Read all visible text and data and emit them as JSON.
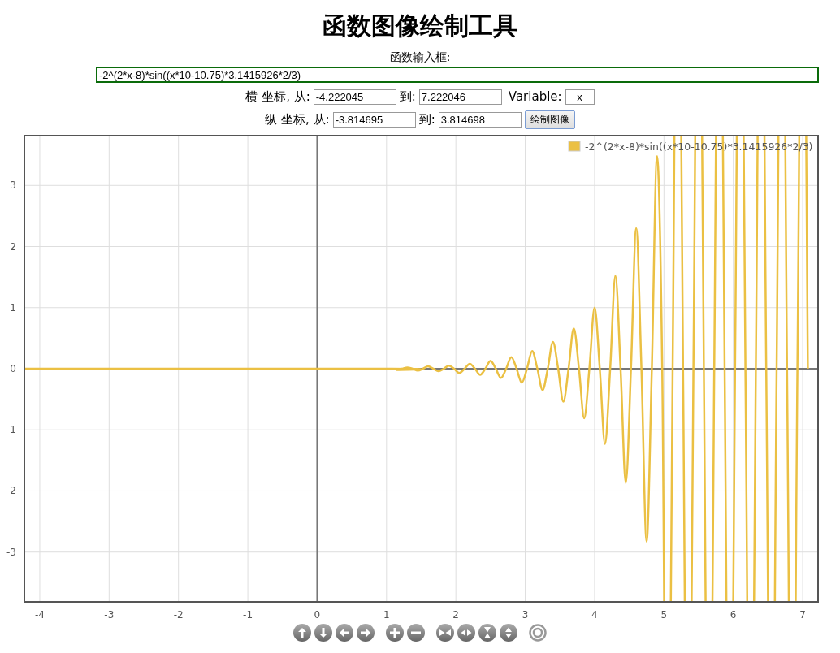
{
  "title": "函数图像绘制工具",
  "function_input": {
    "label": "函数输入框:",
    "value": "-2^(2*x-8)*sin((x*10-10.75)*3.1415926*2/3)"
  },
  "x_range": {
    "label": "横 坐标, 从:",
    "from": "-4.222045",
    "to_label": "到:",
    "to": "7.222046",
    "variable_label": "Variable:",
    "variable": "x"
  },
  "y_range": {
    "label": "纵 坐标, 从:",
    "from": "-3.814695",
    "to_label": "到:",
    "to": "3.814698"
  },
  "draw_button": "绘制图像",
  "plot": {
    "chart_data": {
      "type": "line",
      "x": [
        -4.222,
        1.075,
        1.15,
        1.225,
        1.3,
        1.375,
        1.45,
        1.525,
        1.6,
        1.675,
        1.75,
        1.825,
        1.9,
        1.975,
        2.05,
        2.125,
        2.2,
        2.275,
        2.35,
        2.425,
        2.5,
        2.575,
        2.65,
        2.725,
        2.8,
        2.875,
        2.95,
        3.025,
        3.1,
        3.175,
        3.25,
        3.325,
        3.4,
        3.475,
        3.55,
        3.625,
        3.7,
        3.775,
        3.85,
        3.925,
        4.0,
        4.075,
        4.15,
        4.225,
        4.3,
        4.375,
        4.45,
        4.525,
        4.6,
        4.675,
        4.75,
        4.825,
        4.9,
        4.975,
        5.05,
        5.125,
        5.2,
        5.275,
        5.35,
        5.425,
        5.5,
        5.575,
        5.65,
        5.725,
        5.8,
        5.875,
        5.95,
        6.025,
        6.1,
        6.175,
        6.25,
        6.325,
        6.4,
        6.475,
        6.55,
        6.625,
        6.7,
        6.775,
        6.85,
        6.925,
        7.0,
        7.075
      ],
      "series": [
        {
          "name": "-2^(2*x-8)*sin((x*10-10.75)*3.1415926*2/3)",
          "color": "#ebc043",
          "values": [
            0,
            0,
            -0.02,
            0,
            0.02,
            0,
            -0.03,
            0,
            0.04,
            0,
            -0.04,
            0,
            0.05,
            0,
            -0.07,
            0,
            0.08,
            0,
            -0.1,
            0,
            0.13,
            0,
            -0.15,
            0,
            0.19,
            0,
            -0.23,
            0,
            0.29,
            0,
            -0.35,
            0,
            0.44,
            0,
            -0.54,
            0,
            0.66,
            0,
            -0.81,
            0,
            1,
            0,
            -1.23,
            0,
            1.52,
            0,
            -1.87,
            0,
            2.3,
            0,
            -2.83,
            0,
            3.48,
            0,
            null,
            0,
            null,
            0,
            null,
            0,
            null,
            0,
            null,
            0,
            null,
            0,
            null,
            0,
            null,
            0,
            null,
            0,
            null,
            0,
            null,
            0,
            null,
            0,
            null,
            0,
            null,
            0
          ]
        }
      ],
      "grid": true,
      "xlim": [
        -4.222045,
        7.222046
      ],
      "ylim": [
        -3.814695,
        3.814698
      ],
      "xticks": [
        -4,
        -3,
        -2,
        -1,
        0,
        1,
        2,
        3,
        4,
        5,
        6,
        7
      ],
      "yticks": [
        -3,
        -2,
        -1,
        0,
        1,
        2,
        3
      ]
    }
  },
  "toolbar": [
    {
      "kind": "pan-up"
    },
    {
      "kind": "pan-down"
    },
    {
      "kind": "pan-left"
    },
    {
      "kind": "pan-right"
    },
    {
      "kind": "zoom-in"
    },
    {
      "kind": "zoom-out"
    },
    {
      "kind": "shrink-x"
    },
    {
      "kind": "stretch-x"
    },
    {
      "kind": "shrink-y"
    },
    {
      "kind": "stretch-y"
    },
    {
      "kind": "reset"
    }
  ]
}
